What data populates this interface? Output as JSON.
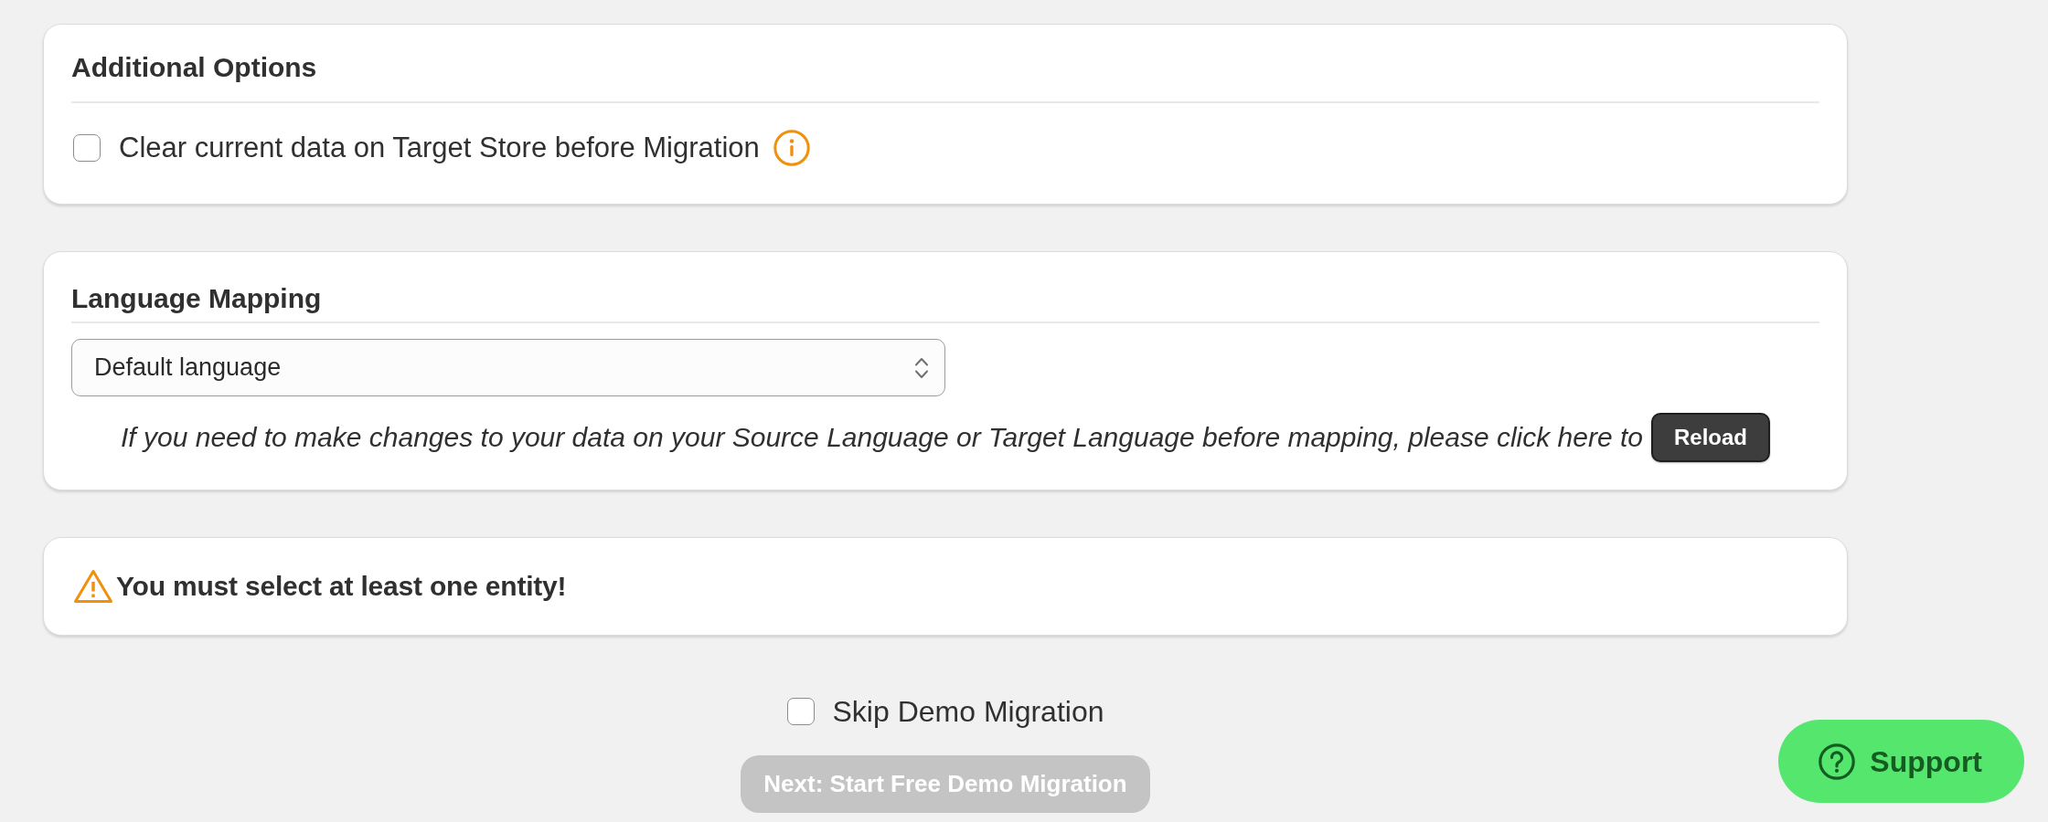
{
  "additional_options": {
    "title": "Additional Options",
    "options": [
      {
        "label": "Clear current data on Target Store before Migration",
        "checked": false
      }
    ]
  },
  "language_mapping": {
    "title": "Language Mapping",
    "language_select": {
      "value": "Default language"
    },
    "note": "If you need to make changes to your data on your Source Language or Target Language before mapping, please click here to",
    "reload_button": {
      "label": "Reload"
    }
  },
  "alert": {
    "kind": "warning",
    "message": "You must select at least one entity!"
  },
  "skip_demo_migration": {
    "label": "Skip Demo Migration",
    "checked": false
  },
  "next_button": {
    "label": "Next: Start Free Demo Migration",
    "disabled": true
  },
  "support_button": {
    "label": "Support"
  }
}
